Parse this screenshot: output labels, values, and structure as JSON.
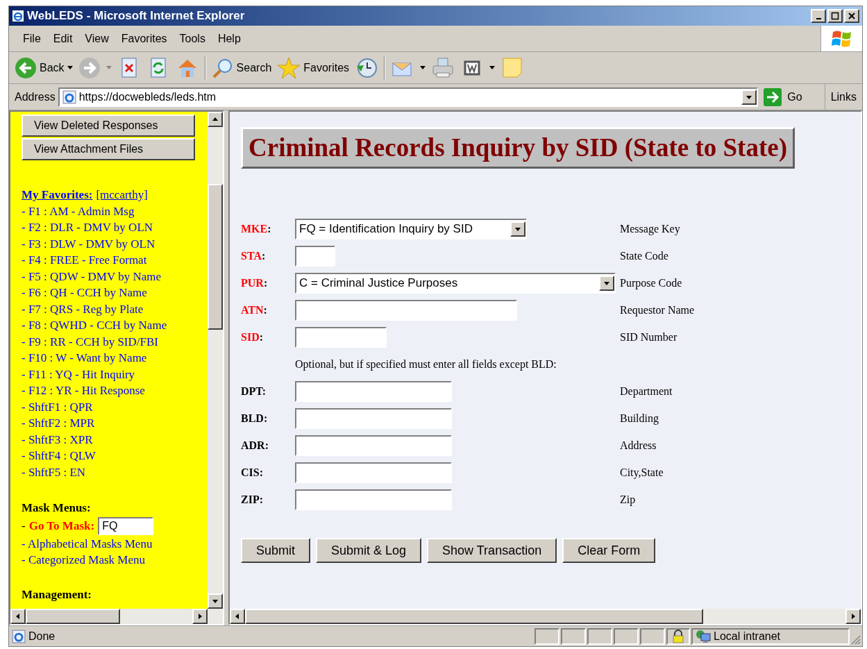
{
  "window": {
    "title": "WebLEDS - Microsoft Internet Explorer"
  },
  "menu": [
    "File",
    "Edit",
    "View",
    "Favorites",
    "Tools",
    "Help"
  ],
  "toolbar": {
    "back": "Back",
    "search": "Search",
    "favorites": "Favorites"
  },
  "address_bar": {
    "label": "Address",
    "url": "https://docwebleds/leds.htm",
    "go": "Go",
    "links": "Links"
  },
  "sidebar": {
    "buttons": [
      "View Deleted Responses",
      "View Attachment Files"
    ],
    "favorites_link": "My Favorites:",
    "favorites_user": "[mccarthy]",
    "favorites": [
      "- F1 : AM - Admin Msg",
      "- F2 : DLR - DMV by OLN",
      "- F3 : DLW - DMV by OLN",
      "- F4 : FREE - Free Format",
      "- F5 : QDW - DMV by Name",
      "- F6 : QH - CCH by Name",
      "- F7 : QRS - Reg by Plate",
      "- F8 : QWHD - CCH by Name",
      "- F9 : RR - CCH by SID/FBI",
      "- F10 : W - Want by Name",
      "- F11 : YQ - Hit Inquiry",
      "- F12 : YR - Hit Response",
      "- ShftF1 : QPR",
      "- ShftF2 : MPR",
      "- ShftF3 : XPR",
      "- ShftF4 : QLW",
      "- ShftF5 : EN"
    ],
    "mask_menus": "Mask Menus:",
    "goto_dash": "-",
    "goto_label": "Go To Mask:",
    "goto_value": "FQ",
    "mask_links": [
      "- Alphabetical Masks Menu",
      "- Categorized Mask Menu"
    ],
    "management": "Management:"
  },
  "form": {
    "title": "Criminal Records Inquiry by SID (State to State)",
    "fields": [
      {
        "kind": "select",
        "label": "MKE",
        "colon": ":",
        "required": true,
        "value": "FQ = Identification Inquiry by SID",
        "description": "Message Key"
      },
      {
        "kind": "text",
        "label": "STA",
        "colon": ":",
        "required": true,
        "description": "State Code"
      },
      {
        "kind": "select",
        "label": "PUR",
        "colon": ":",
        "required": true,
        "value": "C = Criminal Justice Purposes",
        "description": "Purpose Code"
      },
      {
        "kind": "text",
        "label": "ATN",
        "colon": ":",
        "required": true,
        "description": "Requestor Name"
      },
      {
        "kind": "text",
        "label": "SID",
        "colon": ":",
        "required": true,
        "description": "SID Number"
      },
      {
        "kind": "note",
        "text": "Optional, but if specified must enter all fields except BLD:"
      },
      {
        "kind": "text",
        "label": "DPT",
        "colon": ":",
        "required": false,
        "description": "Department"
      },
      {
        "kind": "text",
        "label": "BLD",
        "colon": ":",
        "required": false,
        "description": "Building"
      },
      {
        "kind": "text",
        "label": "ADR",
        "colon": ":",
        "required": false,
        "description": "Address"
      },
      {
        "kind": "text",
        "label": "CIS",
        "colon": ":",
        "required": false,
        "description": "City,State"
      },
      {
        "kind": "text",
        "label": "ZIP",
        "colon": ":",
        "required": false,
        "description": "Zip"
      }
    ],
    "buttons": [
      "Submit",
      "Submit & Log",
      "Show Transaction",
      "Clear Form"
    ]
  },
  "status_bar": {
    "text": "Done",
    "zone": "Local intranet"
  }
}
